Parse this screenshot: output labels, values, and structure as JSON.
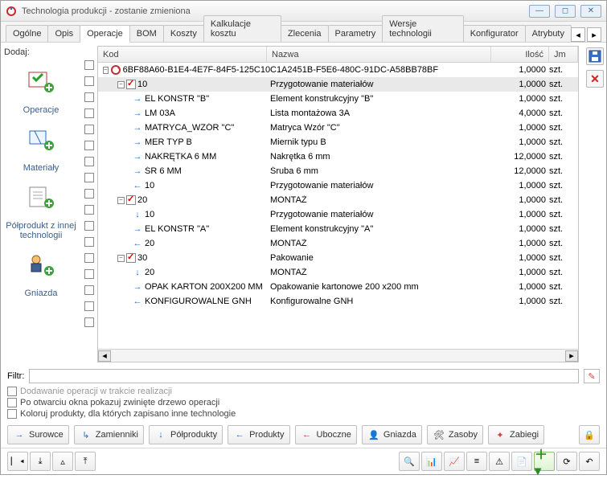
{
  "window": {
    "title": "Technologia produkcji - zostanie zmieniona"
  },
  "tabs": [
    "Ogólne",
    "Opis",
    "Operacje",
    "BOM",
    "Koszty",
    "Kalkulacje kosztu",
    "Zlecenia",
    "Parametry",
    "Wersje technologii",
    "Konfigurator",
    "Atrybuty"
  ],
  "activeTab": 2,
  "addLabel": "Dodaj:",
  "sidebar": [
    {
      "label": "Operacje"
    },
    {
      "label": "Materiały"
    },
    {
      "label": "Półprodukt z innej technologii"
    },
    {
      "label": "Gniazda"
    }
  ],
  "columns": {
    "kod": "Kod",
    "nazwa": "Nazwa",
    "ilosc": "Ilość",
    "jm": "Jm"
  },
  "rows": [
    {
      "indent": 0,
      "exp": "−",
      "icon": "refresh",
      "mark": "",
      "kod": "6BF88A60-B1E4-4E7F-84F5-125C105",
      "nazwa": "C1A2451B-F5E6-480C-91DC-A58BB78BF",
      "ilosc": "1,0000",
      "jm": "szt."
    },
    {
      "indent": 1,
      "exp": "−",
      "icon": "check",
      "mark": "",
      "kod": "10",
      "nazwa": "Przygotowanie materiałów",
      "ilosc": "1,0000",
      "jm": "szt."
    },
    {
      "indent": 2,
      "exp": "",
      "icon": "arrow-rt",
      "mark": "",
      "kod": "EL KONSTR \"B\"",
      "nazwa": "Element konstrukcyjny \"B\"",
      "ilosc": "1,0000",
      "jm": "szt."
    },
    {
      "indent": 2,
      "exp": "",
      "icon": "arrow-rt",
      "mark": "",
      "kod": "LM 03A",
      "nazwa": "Lista montażowa 3A",
      "ilosc": "4,0000",
      "jm": "szt."
    },
    {
      "indent": 2,
      "exp": "",
      "icon": "arrow-rt",
      "mark": "",
      "kod": "MATRYCA_WZÓR \"C\"",
      "nazwa": "Matryca Wzór \"C\"",
      "ilosc": "1,0000",
      "jm": "szt."
    },
    {
      "indent": 2,
      "exp": "",
      "icon": "arrow-rt",
      "mark": "",
      "kod": "MER TYP B",
      "nazwa": "Miernik typu B",
      "ilosc": "1,0000",
      "jm": "szt."
    },
    {
      "indent": 2,
      "exp": "",
      "icon": "arrow-rt",
      "mark": "",
      "kod": "NAKRĘTKA 6 MM",
      "nazwa": "Nakrętka 6 mm",
      "ilosc": "12,0000",
      "jm": "szt."
    },
    {
      "indent": 2,
      "exp": "",
      "icon": "arrow-rt",
      "mark": "",
      "kod": "ŚR 6 MM",
      "nazwa": "Śruba 6 mm",
      "ilosc": "12,0000",
      "jm": "szt."
    },
    {
      "indent": 2,
      "exp": "",
      "icon": "arrow-lt",
      "mark": "",
      "kod": "10",
      "nazwa": "Przygotowanie materiałów",
      "ilosc": "1,0000",
      "jm": "szt."
    },
    {
      "indent": 1,
      "exp": "−",
      "icon": "check",
      "mark": "",
      "kod": "20",
      "nazwa": "MONTAŻ",
      "ilosc": "1,0000",
      "jm": "szt."
    },
    {
      "indent": 2,
      "exp": "",
      "icon": "arrow-dn",
      "mark": "",
      "kod": "10",
      "nazwa": "Przygotowanie materiałów",
      "ilosc": "1,0000",
      "jm": "szt."
    },
    {
      "indent": 2,
      "exp": "",
      "icon": "arrow-rt",
      "mark": "",
      "kod": "EL KONSTR \"A\"",
      "nazwa": "Element konstrukcyjny \"A\"",
      "ilosc": "1,0000",
      "jm": "szt."
    },
    {
      "indent": 2,
      "exp": "",
      "icon": "arrow-lt",
      "mark": "",
      "kod": "20",
      "nazwa": "MONTAŻ",
      "ilosc": "1,0000",
      "jm": "szt."
    },
    {
      "indent": 1,
      "exp": "−",
      "icon": "check",
      "mark": "",
      "kod": "30",
      "nazwa": "Pakowanie",
      "ilosc": "1,0000",
      "jm": "szt."
    },
    {
      "indent": 2,
      "exp": "",
      "icon": "arrow-dn",
      "mark": "",
      "kod": "20",
      "nazwa": "MONTAŻ",
      "ilosc": "1,0000",
      "jm": "szt."
    },
    {
      "indent": 2,
      "exp": "",
      "icon": "arrow-rt",
      "mark": "",
      "kod": "OPAK KARTON 200X200 MM",
      "nazwa": "Opakowanie kartonowe 200 x200 mm",
      "ilosc": "1,0000",
      "jm": "szt."
    },
    {
      "indent": 2,
      "exp": "",
      "icon": "arrow-lt",
      "mark": "",
      "kod": "KONFIGUROWALNE GNH",
      "nazwa": "Konfigurowalne GNH",
      "ilosc": "1,0000",
      "jm": "szt."
    }
  ],
  "filterLabel": "Filtr:",
  "checks": {
    "c1": "Dodawanie operacji w trakcie realizacji",
    "c2": "Po otwarciu okna pokazuj zwinięte drzewo operacji",
    "c3": "Koloruj produkty, dla których zapisano inne technologie"
  },
  "btns": {
    "surowce": "Surowce",
    "zamienniki": "Zamienniki",
    "polprodukty": "Półprodukty",
    "produkty": "Produkty",
    "uboczne": "Uboczne",
    "gniazda": "Gniazda",
    "zasoby": "Zasoby",
    "zabiegi": "Zabiegi"
  }
}
